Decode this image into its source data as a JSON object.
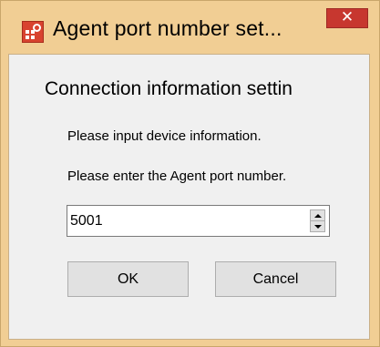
{
  "window": {
    "title": "Agent port number set...",
    "close_glyph": "✕"
  },
  "dialog": {
    "section_title": "Connection information settin",
    "instruction": "Please input device information.",
    "prompt": "Please enter the Agent port number.",
    "port_value": "5001",
    "ok_label": "OK",
    "cancel_label": "Cancel"
  },
  "colors": {
    "frame": "#f1ce94",
    "close_button": "#c7372f",
    "client_background": "#f0f0f0",
    "button_face": "#e1e1e1"
  },
  "icons": {
    "app": "settings-app-icon",
    "close": "close-icon",
    "spin_up": "arrow-up-icon",
    "spin_down": "arrow-down-icon"
  }
}
